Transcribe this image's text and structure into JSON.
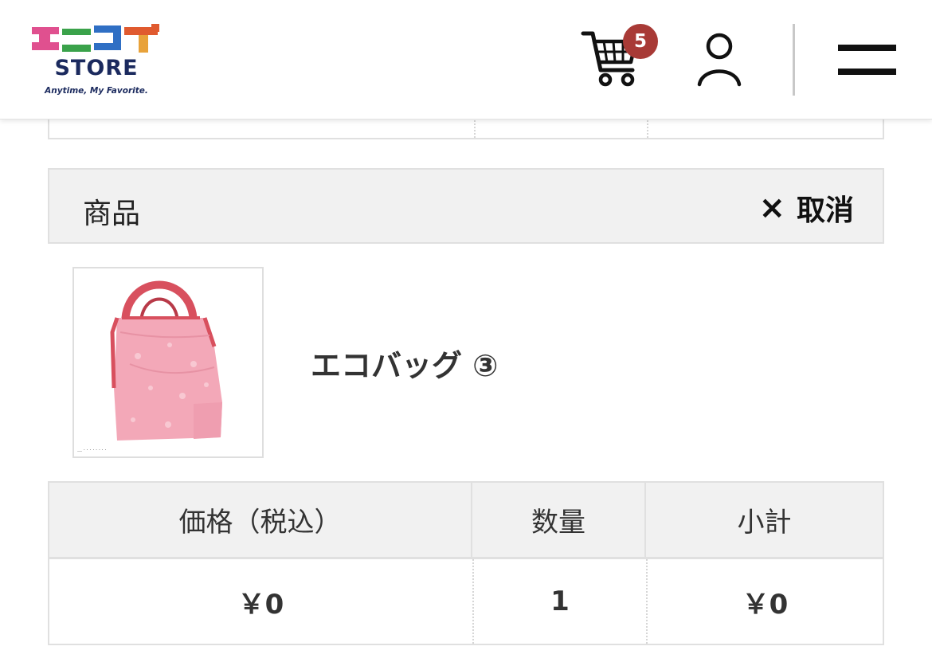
{
  "header": {
    "logo_text": "STORE",
    "logo_tagline": "Anytime, My Favorite.",
    "cart_count": "5",
    "logo_colors": [
      "#e0508f",
      "#3aa24a",
      "#2f6fc4",
      "#e8a23a",
      "#e05a2f"
    ]
  },
  "product_section": {
    "header_label": "商品",
    "cancel_icon": "×",
    "cancel_label": "取消",
    "product_name": "エコバッグ ③",
    "image_caption": "…  ·  ·  ·  ·  ·  ·  ·  ·"
  },
  "price_table": {
    "headers": [
      "価格（税込）",
      "数量",
      "小計"
    ],
    "price": "￥0",
    "quantity": "1",
    "subtotal": "￥0"
  },
  "colors": {
    "badge": "#a83a36",
    "table_header_bg": "#f1f1f1",
    "border": "#e0e0e0"
  }
}
